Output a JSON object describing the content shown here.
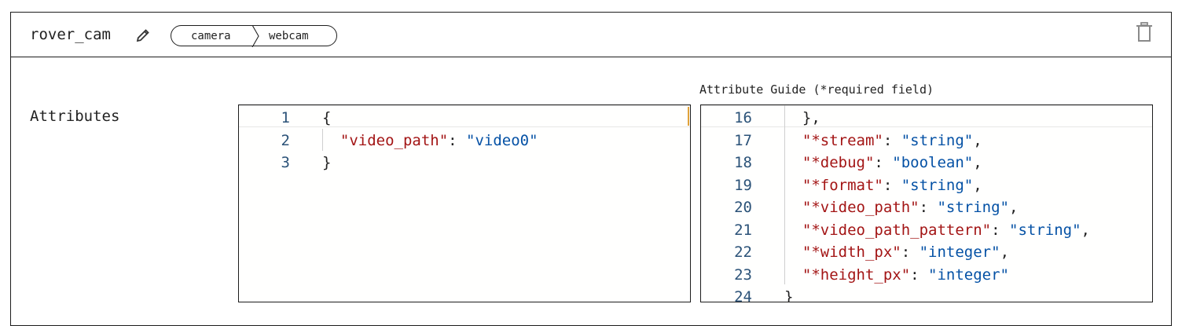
{
  "header": {
    "name": "rover_cam",
    "breadcrumb": [
      "camera",
      "webcam"
    ]
  },
  "attributes_label": "Attributes",
  "guide_title": "Attribute Guide (*required field)",
  "editor": {
    "lines": [
      {
        "n": "1",
        "text": "{"
      },
      {
        "n": "2",
        "key": "\"video_path\"",
        "colon": ": ",
        "value": "\"video0\""
      },
      {
        "n": "3",
        "text": "}"
      }
    ]
  },
  "guide": {
    "lines": [
      {
        "n": "16",
        "text": "  },"
      },
      {
        "n": "17",
        "key": "\"*stream\"",
        "colon": ": ",
        "value": "\"string\"",
        "tail": ","
      },
      {
        "n": "18",
        "key": "\"*debug\"",
        "colon": ": ",
        "value": "\"boolean\"",
        "tail": ","
      },
      {
        "n": "19",
        "key": "\"*format\"",
        "colon": ": ",
        "value": "\"string\"",
        "tail": ","
      },
      {
        "n": "20",
        "key": "\"*video_path\"",
        "colon": ": ",
        "value": "\"string\"",
        "tail": ","
      },
      {
        "n": "21",
        "key": "\"*video_path_pattern\"",
        "colon": ": ",
        "value": "\"string\"",
        "tail": ","
      },
      {
        "n": "22",
        "key": "\"*width_px\"",
        "colon": ": ",
        "value": "\"integer\"",
        "tail": ","
      },
      {
        "n": "23",
        "key": "\"*height_px\"",
        "colon": ": ",
        "value": "\"integer\"",
        "tail": ""
      },
      {
        "n": "24",
        "text": "}"
      }
    ]
  },
  "colors": {
    "key": "#a31515",
    "string": "#0451a5",
    "line_number": "#2b5278",
    "border": "#1d1d1d"
  }
}
